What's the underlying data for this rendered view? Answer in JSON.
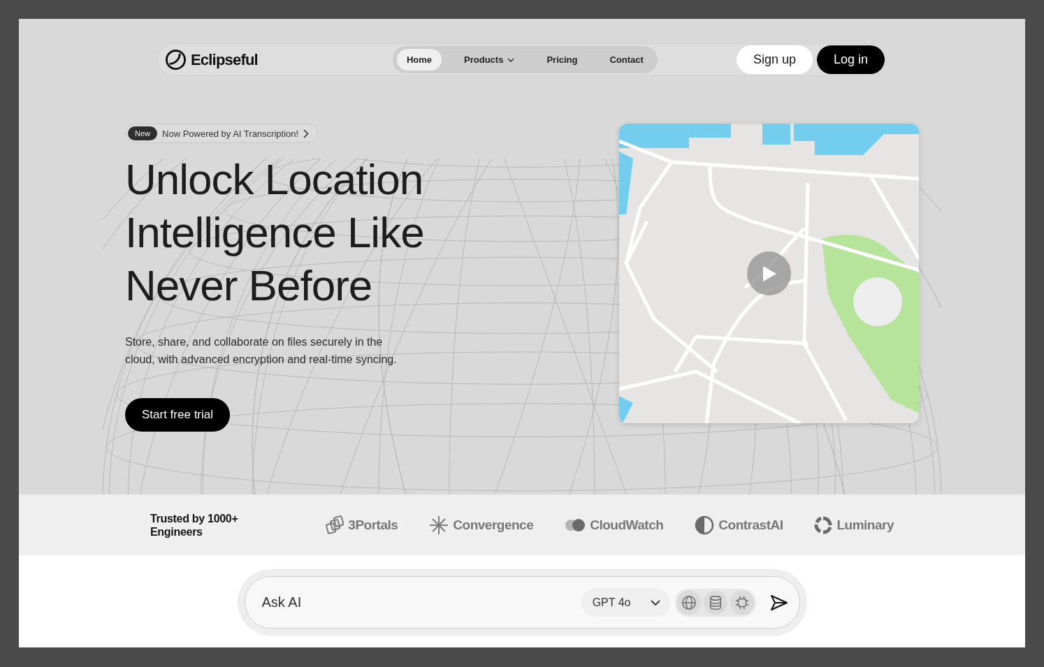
{
  "nav": {
    "brand": "Eclipseful",
    "links": [
      {
        "label": "Home",
        "selected": true,
        "has_menu": false
      },
      {
        "label": "Products",
        "selected": false,
        "has_menu": true
      },
      {
        "label": "Pricing",
        "selected": false,
        "has_menu": false
      },
      {
        "label": "Contact",
        "selected": false,
        "has_menu": false
      }
    ],
    "signup": "Sign up",
    "login": "Log in"
  },
  "hero": {
    "badge": "New",
    "announcement": "Now Powered by AI Transcription!",
    "headline": "Unlock Location Intelligence Like Never Before",
    "description": "Store, share, and collaborate on files securely in the cloud, with advanced encryption and real-time syncing.",
    "cta": "Start free trial"
  },
  "trusted": {
    "label": "Trusted by 1000+ Engineers",
    "logos": [
      {
        "name": "3Portals",
        "kind": "portals"
      },
      {
        "name": "Convergence",
        "kind": "star"
      },
      {
        "name": "CloudWatch",
        "kind": "dots"
      },
      {
        "name": "ContrastAI",
        "kind": "half"
      },
      {
        "name": "Luminary",
        "kind": "ring"
      }
    ]
  },
  "ask": {
    "placeholder": "Ask AI",
    "model": "GPT 4o",
    "tools": [
      {
        "kind": "globe"
      },
      {
        "kind": "database"
      },
      {
        "kind": "chip"
      }
    ]
  }
}
